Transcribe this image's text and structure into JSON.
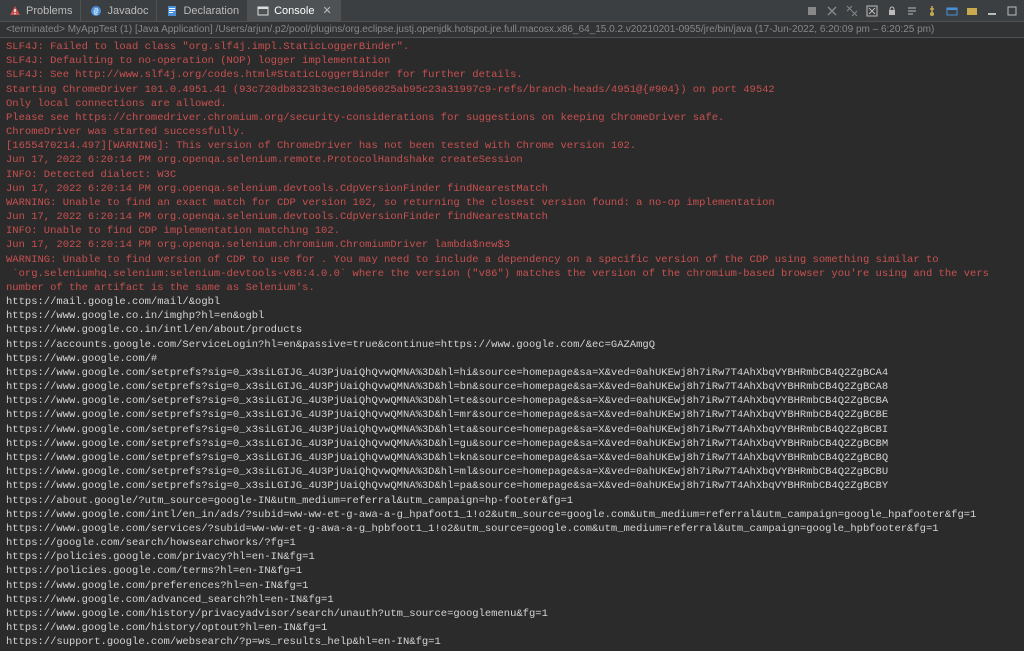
{
  "tabs": {
    "problems": "Problems",
    "javadoc": "Javadoc",
    "declaration": "Declaration",
    "console": "Console"
  },
  "status": "<terminated> MyAppTest (1) [Java Application] /Users/arjun/.p2/pool/plugins/org.eclipse.justj.openjdk.hotspot.jre.full.macosx.x86_64_15.0.2.v20210201-0955/jre/bin/java  (17-Jun-2022, 6:20:09 pm – 6:20:25 pm)",
  "console_red": [
    "SLF4J: Failed to load class \"org.slf4j.impl.StaticLoggerBinder\".",
    "SLF4J: Defaulting to no-operation (NOP) logger implementation",
    "SLF4J: See http://www.slf4j.org/codes.html#StaticLoggerBinder for further details.",
    "Starting ChromeDriver 101.0.4951.41 (93c720db8323b3ec10d056025ab95c23a31997c9-refs/branch-heads/4951@{#904}) on port 49542",
    "Only local connections are allowed.",
    "Please see https://chromedriver.chromium.org/security-considerations for suggestions on keeping ChromeDriver safe.",
    "ChromeDriver was started successfully.",
    "[1655470214.497][WARNING]: This version of ChromeDriver has not been tested with Chrome version 102.",
    "Jun 17, 2022 6:20:14 PM org.openqa.selenium.remote.ProtocolHandshake createSession",
    "INFO: Detected dialect: W3C",
    "Jun 17, 2022 6:20:14 PM org.openqa.selenium.devtools.CdpVersionFinder findNearestMatch",
    "WARNING: Unable to find an exact match for CDP version 102, so returning the closest version found: a no-op implementation",
    "Jun 17, 2022 6:20:14 PM org.openqa.selenium.devtools.CdpVersionFinder findNearestMatch",
    "INFO: Unable to find CDP implementation matching 102.",
    "Jun 17, 2022 6:20:14 PM org.openqa.selenium.chromium.ChromiumDriver lambda$new$3",
    "WARNING: Unable to find version of CDP to use for . You may need to include a dependency on a specific version of the CDP using something similar to",
    " `org.seleniumhq.selenium:selenium-devtools-v86:4.0.0` where the version (\"v86\") matches the version of the chromium-based browser you're using and the vers",
    "number of the artifact is the same as Selenium's."
  ],
  "console_white": [
    "https://mail.google.com/mail/&ogbl",
    "https://www.google.co.in/imghp?hl=en&ogbl",
    "https://www.google.co.in/intl/en/about/products",
    "https://accounts.google.com/ServiceLogin?hl=en&passive=true&continue=https://www.google.com/&ec=GAZAmgQ",
    "https://www.google.com/#",
    "https://www.google.com/setprefs?sig=0_x3siLGIJG_4U3PjUaiQhQvwQMNA%3D&hl=hi&source=homepage&sa=X&ved=0ahUKEwj8h7iRw7T4AhXbqVYBHRmbCB4Q2ZgBCA4",
    "https://www.google.com/setprefs?sig=0_x3siLGIJG_4U3PjUaiQhQvwQMNA%3D&hl=bn&source=homepage&sa=X&ved=0ahUKEwj8h7iRw7T4AhXbqVYBHRmbCB4Q2ZgBCA8",
    "https://www.google.com/setprefs?sig=0_x3siLGIJG_4U3PjUaiQhQvwQMNA%3D&hl=te&source=homepage&sa=X&ved=0ahUKEwj8h7iRw7T4AhXbqVYBHRmbCB4Q2ZgBCBA",
    "https://www.google.com/setprefs?sig=0_x3siLGIJG_4U3PjUaiQhQvwQMNA%3D&hl=mr&source=homepage&sa=X&ved=0ahUKEwj8h7iRw7T4AhXbqVYBHRmbCB4Q2ZgBCBE",
    "https://www.google.com/setprefs?sig=0_x3siLGIJG_4U3PjUaiQhQvwQMNA%3D&hl=ta&source=homepage&sa=X&ved=0ahUKEwj8h7iRw7T4AhXbqVYBHRmbCB4Q2ZgBCBI",
    "https://www.google.com/setprefs?sig=0_x3siLGIJG_4U3PjUaiQhQvwQMNA%3D&hl=gu&source=homepage&sa=X&ved=0ahUKEwj8h7iRw7T4AhXbqVYBHRmbCB4Q2ZgBCBM",
    "https://www.google.com/setprefs?sig=0_x3siLGIJG_4U3PjUaiQhQvwQMNA%3D&hl=kn&source=homepage&sa=X&ved=0ahUKEwj8h7iRw7T4AhXbqVYBHRmbCB4Q2ZgBCBQ",
    "https://www.google.com/setprefs?sig=0_x3siLGIJG_4U3PjUaiQhQvwQMNA%3D&hl=ml&source=homepage&sa=X&ved=0ahUKEwj8h7iRw7T4AhXbqVYBHRmbCB4Q2ZgBCBU",
    "https://www.google.com/setprefs?sig=0_x3siLGIJG_4U3PjUaiQhQvwQMNA%3D&hl=pa&source=homepage&sa=X&ved=0ahUKEwj8h7iRw7T4AhXbqVYBHRmbCB4Q2ZgBCBY",
    "https://about.google/?utm_source=google-IN&utm_medium=referral&utm_campaign=hp-footer&fg=1",
    "https://www.google.com/intl/en_in/ads/?subid=ww-ww-et-g-awa-a-g_hpafoot1_1!o2&utm_source=google.com&utm_medium=referral&utm_campaign=google_hpafooter&fg=1",
    "https://www.google.com/services/?subid=ww-ww-et-g-awa-a-g_hpbfoot1_1!o2&utm_source=google.com&utm_medium=referral&utm_campaign=google_hpbfooter&fg=1",
    "https://google.com/search/howsearchworks/?fg=1",
    "https://policies.google.com/privacy?hl=en-IN&fg=1",
    "https://policies.google.com/terms?hl=en-IN&fg=1",
    "https://www.google.com/preferences?hl=en-IN&fg=1",
    "https://www.google.com/advanced_search?hl=en-IN&fg=1",
    "https://www.google.com/history/privacyadvisor/search/unauth?utm_source=googlemenu&fg=1",
    "https://www.google.com/history/optout?hl=en-IN&fg=1",
    "https://support.google.com/websearch/?p=ws_results_help&hl=en-IN&fg=1"
  ],
  "icons": {
    "problems": "⚠",
    "javadoc": "@",
    "declaration": "📄",
    "console": "▣",
    "close": "✕"
  }
}
